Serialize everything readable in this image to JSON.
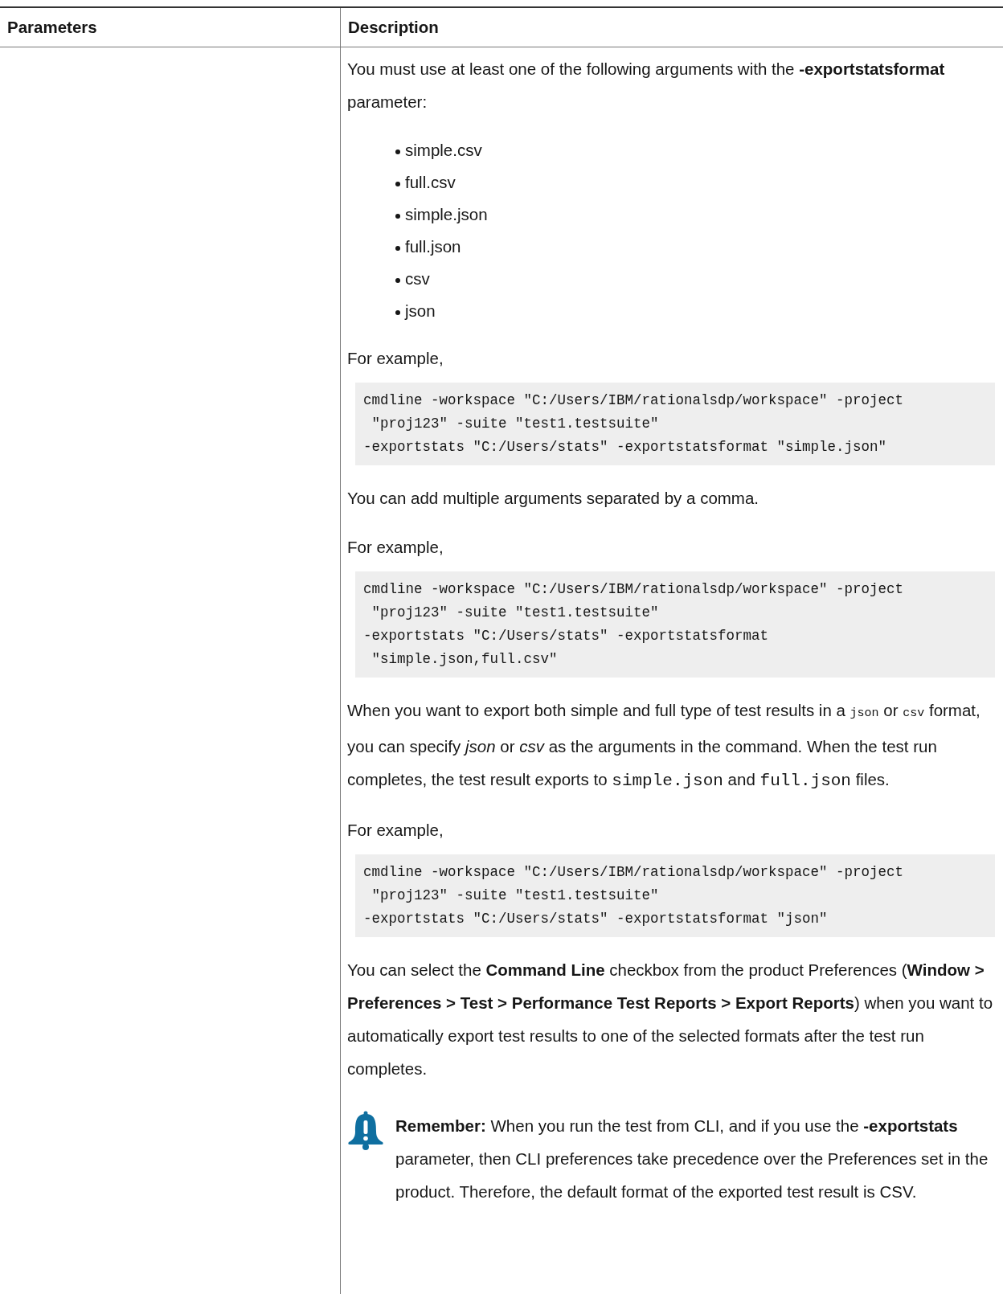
{
  "table": {
    "columns": [
      "Parameters",
      "Description"
    ],
    "rows": [
      {
        "parameter": "",
        "blocks": [
          {
            "kind": "paragraph",
            "segments": [
              {
                "kind": "text",
                "text": "You must use at least one of the following arguments with the **-exportstatsformat** parameter:"
              }
            ]
          },
          {
            "kind": "list",
            "items": [
              "simple.csv",
              "full.csv",
              "simple.json",
              "full.json",
              "csv",
              "json"
            ]
          },
          {
            "kind": "paragraph",
            "segments": [
              {
                "kind": "text",
                "text": "For example,"
              }
            ]
          },
          {
            "kind": "code",
            "lines": [
              "cmdline -workspace \"C:/Users/IBM/rationalsdp/workspace\" -project",
              " \"proj123\" -suite \"test1.testsuite\"",
              "-exportstats \"C:/Users/stats\" -exportstatsformat \"simple.json\""
            ]
          },
          {
            "kind": "paragraph",
            "segments": [
              {
                "kind": "text",
                "text": "You can add multiple arguments separated by a comma."
              }
            ]
          },
          {
            "kind": "paragraph",
            "segments": [
              {
                "kind": "text",
                "text": "For example,"
              }
            ]
          },
          {
            "kind": "code",
            "lines": [
              "cmdline -workspace \"C:/Users/IBM/rationalsdp/workspace\" -project",
              " \"proj123\" -suite \"test1.testsuite\"",
              "-exportstats \"C:/Users/stats\" -exportstatsformat",
              " \"simple.json,full.csv\""
            ]
          },
          {
            "kind": "paragraph",
            "segments": [
              {
                "kind": "text",
                "text": "When you want to export both simple and full type of test results in a "
              },
              {
                "kind": "code",
                "text": "json"
              },
              {
                "kind": "text",
                "text": " or "
              },
              {
                "kind": "code",
                "text": "csv"
              },
              {
                "kind": "text",
                "text": " format, you can specify *json* or *csv* as the arguments in the command. When the test run completes, the test result exports to "
              },
              {
                "kind": "tt",
                "text": "simple.json"
              },
              {
                "kind": "text",
                "text": " and "
              },
              {
                "kind": "tt",
                "text": "full.json"
              },
              {
                "kind": "text",
                "text": " files."
              }
            ]
          },
          {
            "kind": "paragraph",
            "segments": [
              {
                "kind": "text",
                "text": "For example,"
              }
            ]
          },
          {
            "kind": "code",
            "lines": [
              "cmdline -workspace \"C:/Users/IBM/rationalsdp/workspace\" -project",
              " \"proj123\" -suite \"test1.testsuite\"",
              "-exportstats \"C:/Users/stats\" -exportstatsformat \"json\""
            ]
          },
          {
            "kind": "paragraph",
            "segments": [
              {
                "kind": "text",
                "text": "You can select the **Command Line** checkbox from the product Preferences (**Window > Preferences > Test > Performance Test Reports > Export Reports**) when you want to automatically export test results to one of the selected formats after the test run completes."
              }
            ]
          },
          {
            "kind": "note",
            "segments": [
              {
                "kind": "text",
                "text": "**Remember:** When you run the test from CLI, and if you use the **-exportstats** parameter, then CLI preferences take precedence over the Preferences set in the product. Therefore, the default format of the exported test result is CSV."
              }
            ]
          }
        ]
      }
    ]
  }
}
